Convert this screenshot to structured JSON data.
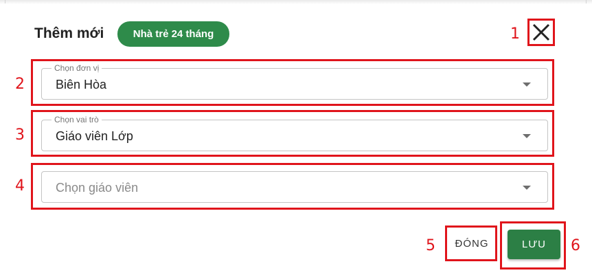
{
  "dialog": {
    "title": "Thêm mới",
    "badge": "Nhà trẻ 24 tháng"
  },
  "fields": [
    {
      "legend": "Chọn đơn vị",
      "value": "Biên Hòa"
    },
    {
      "legend": "Chọn vai trò",
      "value": "Giáo viên Lớp"
    },
    {
      "placeholder": "Chọn giáo viên"
    }
  ],
  "buttons": {
    "close": "ĐÓNG",
    "save": "LƯU"
  },
  "annotations": [
    "1",
    "2",
    "3",
    "4",
    "5",
    "6"
  ],
  "colors": {
    "badge": "#2e8b4a",
    "save_button": "#2c7f45",
    "annotation": "#e0141b",
    "field_border": "#c4c4c4"
  },
  "icons": {
    "close": "close-icon",
    "dropdown": "chevron-down-icon"
  }
}
